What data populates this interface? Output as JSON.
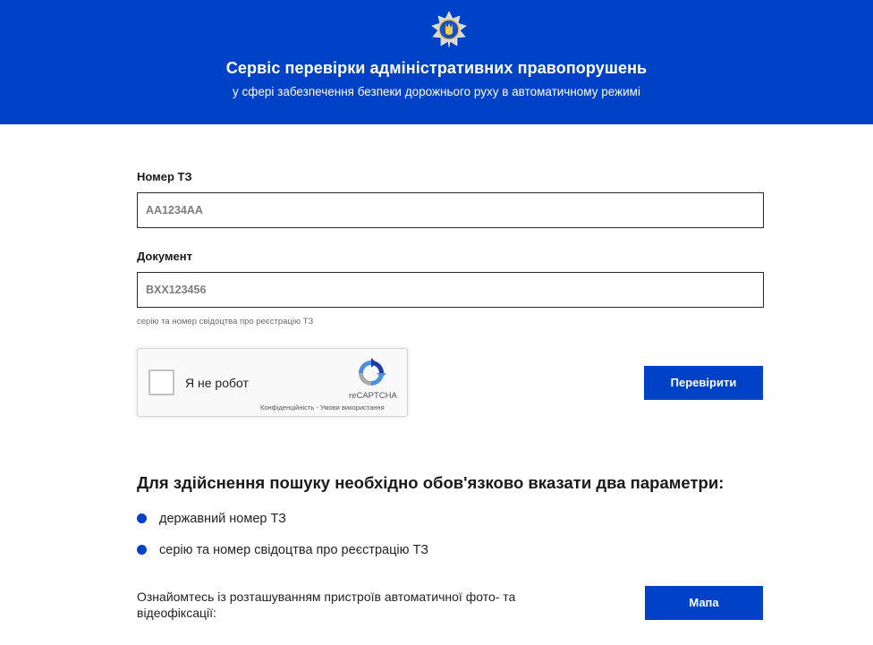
{
  "header": {
    "title": "Сервіс перевірки адміністративних правопорушень",
    "subtitle": "у сфері забезпечення безпеки дорожнього руху в автоматичному режимі",
    "emblem_icon": "police-emblem-icon"
  },
  "form": {
    "vehicle_number": {
      "label": "Номер ТЗ",
      "placeholder": "AA1234AA",
      "value": ""
    },
    "document": {
      "label": "Документ",
      "placeholder": "BXX123456",
      "value": "",
      "hint": "серію та номер свідоцтва про реєстрацію ТЗ"
    },
    "check_button": "Перевірити"
  },
  "recaptcha": {
    "label": "Я не робот",
    "brand": "reCAPTCHA",
    "privacy": "Конфіденційність",
    "separator": " - ",
    "terms": "Умови використання",
    "checked": false
  },
  "info": {
    "title": "Для здійснення пошуку необхідно обов'язково вказати два параметри:",
    "items": [
      "державний номер ТЗ",
      "серію та номер свідоцтва про реєстрацію ТЗ"
    ],
    "map_text": "Ознайомтесь із розташуванням пристроїв автоматичної фото- та відеофіксації:",
    "map_button": "Мапа"
  },
  "colors": {
    "primary": "#0042c7",
    "text": "#1c1c1c",
    "border": "#2a2a2a"
  }
}
